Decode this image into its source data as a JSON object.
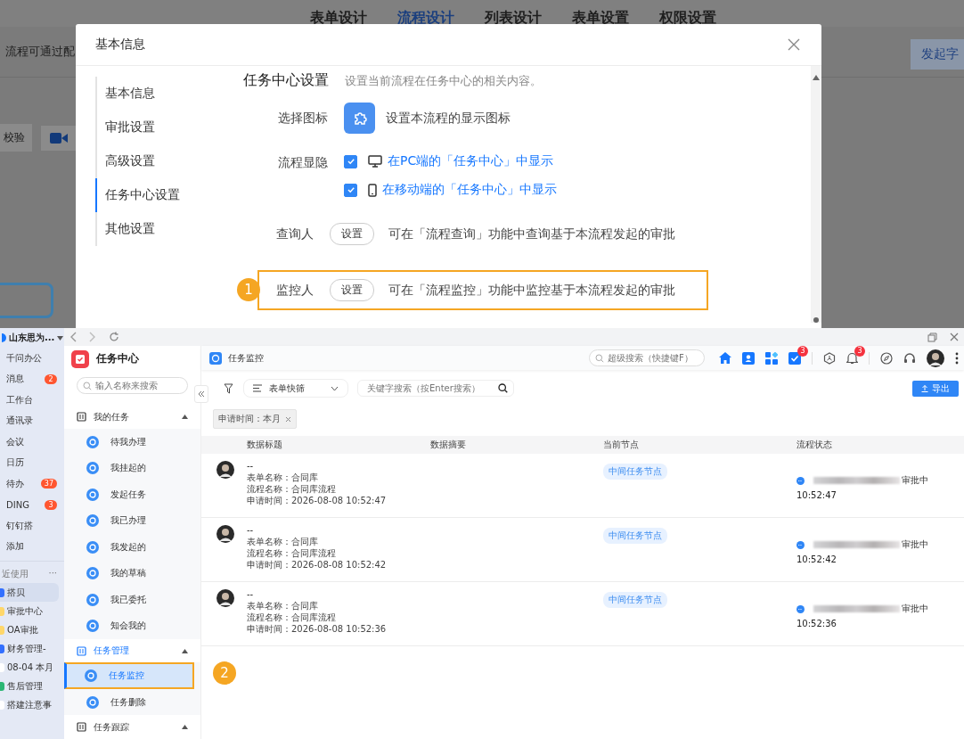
{
  "background_page": {
    "tabs": [
      {
        "label": "表单设计",
        "selected": false
      },
      {
        "label": "流程设计",
        "selected": true
      },
      {
        "label": "列表设计",
        "selected": false
      },
      {
        "label": "表单设置",
        "selected": false
      },
      {
        "label": "权限设置",
        "selected": false
      }
    ],
    "notice": "流程可通过配",
    "start_button": "发起字",
    "check_button": "校验"
  },
  "dialog": {
    "title": "基本信息",
    "nav": [
      {
        "label": "基本信息",
        "selected": false
      },
      {
        "label": "审批设置",
        "selected": false
      },
      {
        "label": "高级设置",
        "selected": false
      },
      {
        "label": "任务中心设置",
        "selected": true
      },
      {
        "label": "其他设置",
        "selected": false
      }
    ],
    "section_title": "任务中心设置",
    "section_desc": "设置当前流程在任务中心的相关内容。",
    "rows": [
      {
        "kind": "icon",
        "label": "选择图标",
        "text": "设置本流程的显示图标"
      },
      {
        "kind": "checks",
        "label": "流程显隐",
        "options": [
          {
            "kind": "pc",
            "text": "在PC端的「任务中心」中显示",
            "checked": true
          },
          {
            "kind": "mobile",
            "text": "在移动端的「任务中心」中显示",
            "checked": true
          }
        ]
      },
      {
        "kind": "setting",
        "label": "查询人",
        "button": "设置",
        "text": "可在「流程查询」功能中查询基于本流程发起的审批",
        "highlighted": false
      },
      {
        "kind": "setting",
        "label": "监控人",
        "button": "设置",
        "text": "可在「流程监控」功能中监控基于本流程发起的审批",
        "highlighted": true,
        "step": "1"
      }
    ]
  },
  "app": {
    "org": "山东思为...",
    "nav": [
      {
        "label": "千问办公"
      },
      {
        "label": "消息",
        "badge": "2"
      },
      {
        "label": "工作台"
      },
      {
        "label": "通讯录"
      },
      {
        "label": "会议"
      },
      {
        "label": "日历"
      },
      {
        "label": "待办",
        "badge": "37"
      },
      {
        "label": "DING",
        "badge": "3"
      },
      {
        "label": "钉钉搭"
      },
      {
        "label": "添加"
      }
    ],
    "recent_title": "近使用",
    "recent_more": "···",
    "recent": [
      {
        "label": "搭贝",
        "selected": true,
        "color": "#3370ff"
      },
      {
        "label": "审批中心",
        "selected": false,
        "color": "#ffd76a"
      },
      {
        "label": "OA审批",
        "selected": false,
        "color": "#ffd76a"
      },
      {
        "label": "财务管理-",
        "selected": false,
        "color": "#3370ff"
      },
      {
        "label": "08-04 本月",
        "selected": false,
        "color": "#ffffff"
      },
      {
        "label": "售后管理",
        "selected": false,
        "color": "#2bb673"
      },
      {
        "label": "搭建注意事",
        "selected": false,
        "color": "#ffffff"
      }
    ],
    "module_title": "任务中心",
    "module_search": {
      "placeholder": "输入名称来搜索"
    },
    "groups": [
      {
        "label": "我的任务",
        "expanded": true,
        "active": false,
        "items": [
          {
            "label": "待我办理",
            "selected": false
          },
          {
            "label": "我挂起的",
            "selected": false
          },
          {
            "label": "发起任务",
            "selected": false
          },
          {
            "label": "我已办理",
            "selected": false
          },
          {
            "label": "我发起的",
            "selected": false
          },
          {
            "label": "我的草稿",
            "selected": false
          },
          {
            "label": "我已委托",
            "selected": false
          },
          {
            "label": "知会我的",
            "selected": false
          }
        ]
      },
      {
        "label": "任务管理",
        "expanded": true,
        "active": true,
        "items": [
          {
            "label": "任务监控",
            "selected": true,
            "step": "2"
          },
          {
            "label": "任务删除",
            "selected": false
          }
        ]
      },
      {
        "label": "任务跟踪",
        "expanded": true,
        "active": false
      }
    ],
    "page_title": "任务监控",
    "global_search": {
      "placeholder": "超级搜索（快捷键F）"
    },
    "header_badges": {
      "tasks": "3",
      "notifications": "3"
    },
    "quick_filter": "表单快筛",
    "keyword_search": {
      "placeholder": "关键字搜索（按Enter搜索）"
    },
    "export_button": "导出",
    "filter_tag": "申请时间：本月",
    "columns": [
      "数据标题",
      "数据摘要",
      "当前节点",
      "流程状态"
    ],
    "rows": [
      {
        "title": "--",
        "form": "表单名称：合同库",
        "flow": "流程名称：合同库流程",
        "time": "申请时间：2026-08-08 10:52:47",
        "node": "中间任务节点",
        "status": "审批中",
        "status_time": "10:52:47"
      },
      {
        "title": "--",
        "form": "表单名称：合同库",
        "flow": "流程名称：合同库流程",
        "time": "申请时间：2026-08-08 10:52:42",
        "node": "中间任务节点",
        "status": "审批中",
        "status_time": "10:52:42"
      },
      {
        "title": "--",
        "form": "表单名称：合同库",
        "flow": "流程名称：合同库流程",
        "time": "申请时间：2026-08-08 10:52:36",
        "node": "中间任务节点",
        "status": "审批中",
        "status_time": "10:52:36"
      }
    ]
  }
}
